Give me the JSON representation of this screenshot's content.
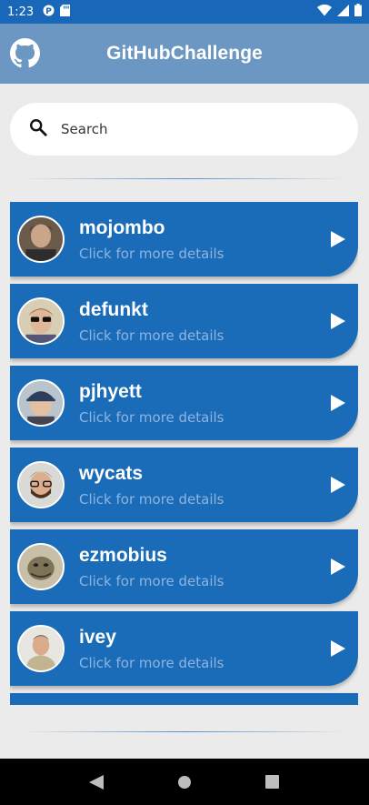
{
  "status_bar": {
    "time": "1:23",
    "icons_left": [
      "p-icon",
      "sd-card-icon"
    ],
    "icons_right": [
      "wifi-icon",
      "signal-icon",
      "battery-icon"
    ]
  },
  "app_bar": {
    "title": "GitHubChallenge",
    "logo_icon": "github-icon",
    "background": "#6c97c3"
  },
  "search": {
    "placeholder": "Search",
    "value": "",
    "icon": "search-icon"
  },
  "colors": {
    "accent": "#1967b8",
    "card": "#1a6cb8",
    "subtitle": "#8fb4e0",
    "background": "#ebebeb"
  },
  "users": [
    {
      "login": "mojombo",
      "subtitle": "Click for more details"
    },
    {
      "login": "defunkt",
      "subtitle": "Click for more details"
    },
    {
      "login": "pjhyett",
      "subtitle": "Click for more details"
    },
    {
      "login": "wycats",
      "subtitle": "Click for more details"
    },
    {
      "login": "ezmobius",
      "subtitle": "Click for more details"
    },
    {
      "login": "ivey",
      "subtitle": "Click for more details"
    }
  ],
  "nav_bar": {
    "buttons": [
      "back-icon",
      "home-icon",
      "recents-icon"
    ]
  }
}
